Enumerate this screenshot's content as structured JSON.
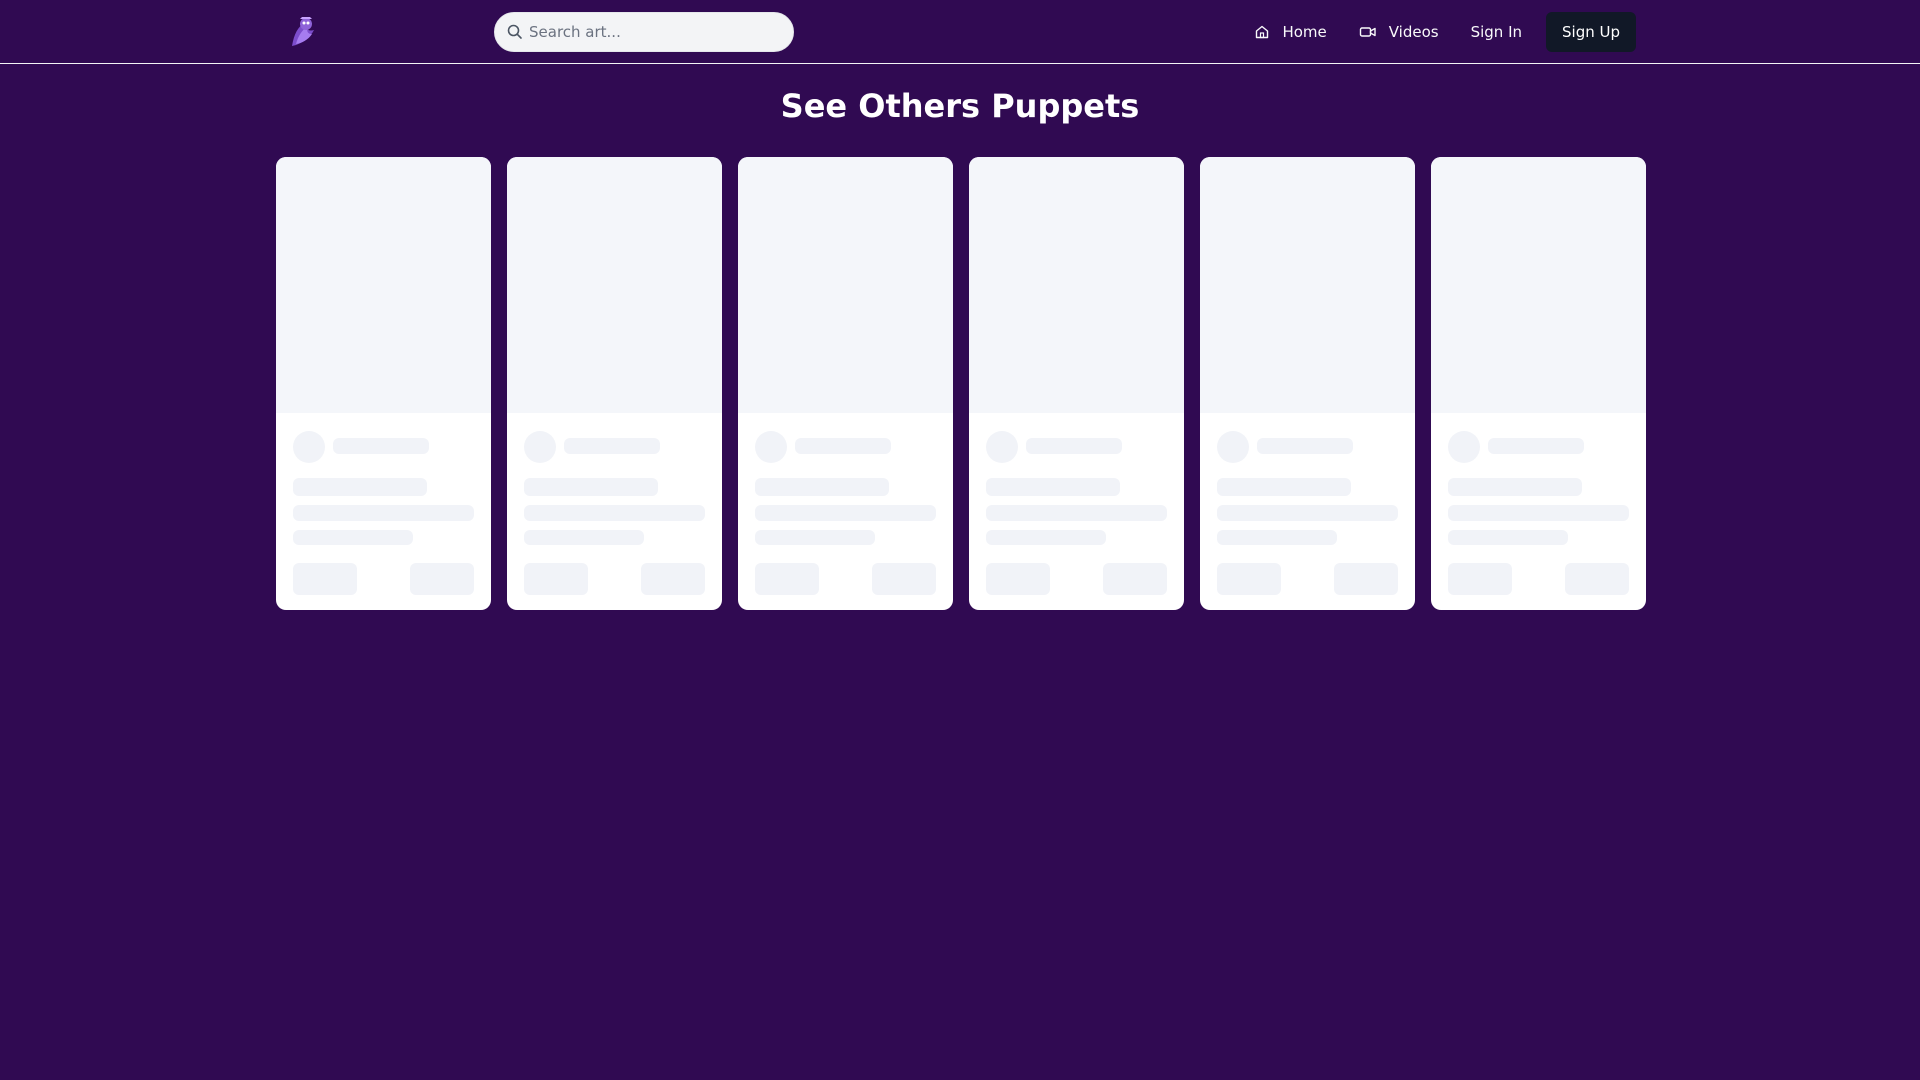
{
  "header": {
    "logo_icon": "puppet-logo-icon",
    "search": {
      "placeholder": "Search art...",
      "value": ""
    },
    "nav": {
      "home_label": "Home",
      "videos_label": "Videos",
      "signin_label": "Sign In",
      "signup_label": "Sign Up"
    }
  },
  "main": {
    "title": "See Others Puppets",
    "card_count": 6
  },
  "colors": {
    "background": "#300a52",
    "card": "#ffffff",
    "skeleton": "#f1f3f8",
    "signup_button": "#111827"
  }
}
